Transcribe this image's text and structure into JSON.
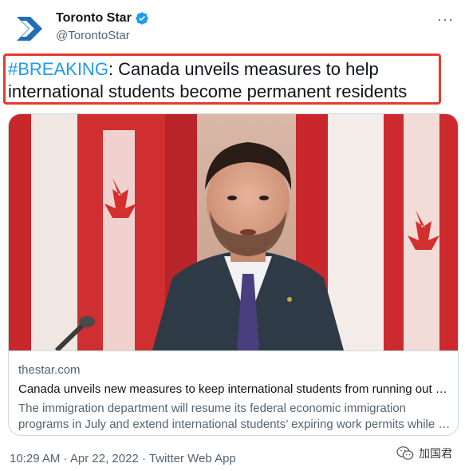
{
  "account": {
    "display_name": "Toronto Star",
    "handle": "@TorontoStar",
    "verified": true,
    "more_icon": "ellipsis-icon"
  },
  "tweet": {
    "hashtag": "#BREAKING",
    "text": ": Canada unveils measures to help international students become permanent residents",
    "highlight_color": "#e53b2c"
  },
  "card": {
    "domain": "thestar.com",
    "title": "Canada unveils new measures to keep international students from running out …",
    "description_line1": "The immigration department will resume its federal economic immigration",
    "description_line2": "programs in July and extend international students’ expiring work permits while …"
  },
  "meta": {
    "timestamp": "10:29 AM · Apr 22, 2022 · Twitter Web App"
  },
  "watermark": {
    "text": "加国君",
    "icon": "wechat-icon"
  },
  "colors": {
    "link": "#1d9bf0",
    "secondary_text": "#536471",
    "brand": "#1d6fb8"
  }
}
